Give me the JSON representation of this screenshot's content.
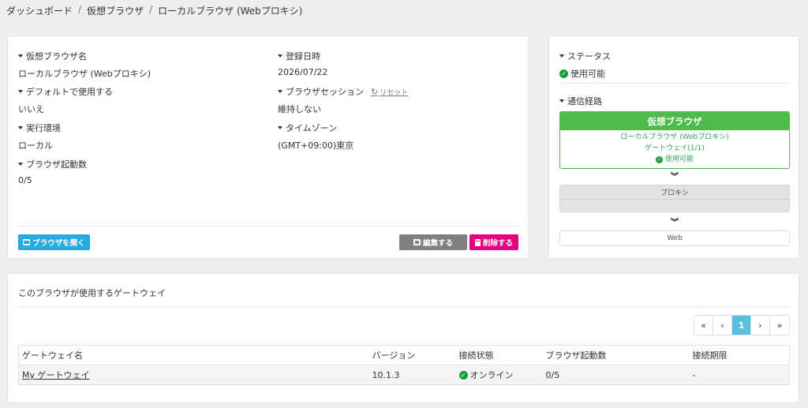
{
  "breadcrumb": {
    "items": [
      "ダッシュボード",
      "仮想ブラウザ",
      "ローカルブラウザ (Webプロキシ)"
    ],
    "separator": "/"
  },
  "details": {
    "name_label": "仮想ブラウザ名",
    "name_value": "ローカルブラウザ (Webプロキシ)",
    "registered_label": "登録日時",
    "registered_value": "2026/07/22",
    "default_label": "デフォルトで使用する",
    "default_value": "いいえ",
    "session_label": "ブラウザセッション",
    "session_reset": "リセット",
    "session_value": "維持しない",
    "env_label": "実行環境",
    "env_value": "ローカル",
    "tz_label": "タイムゾーン",
    "tz_value": "(GMT+09:00)東京",
    "launch_label": "ブラウザ起動数",
    "launch_value": "0/5"
  },
  "actions": {
    "open_label": "ブラウザを開く",
    "edit_label": "編集する",
    "delete_label": "削除する"
  },
  "status": {
    "status_label": "ステータス",
    "status_value": "使用可能",
    "route_label": "通信経路",
    "vb_header": "仮想ブラウザ",
    "vb_name": "ローカルブラウザ (Webプロキシ)",
    "vb_gateway": "ゲートウェイ(1/1)",
    "vb_status": "使用可能",
    "proxy_header": "プロキシ",
    "web_label": "Web"
  },
  "gateways": {
    "title": "このブラウザが使用するゲートウェイ",
    "pager": {
      "first": "«",
      "prev": "‹",
      "page": "1",
      "next": "›",
      "last": "»"
    },
    "columns": [
      "ゲートウェイ名",
      "バージョン",
      "接続状態",
      "ブラウザ起動数",
      "接続期限"
    ],
    "rows": [
      {
        "name": "My ゲートウェイ",
        "version": "10.1.3",
        "state": "オンライン",
        "launches": "0/5",
        "expiry": "-"
      }
    ]
  },
  "colors": {
    "accent_blue": "#29a9e0",
    "delete_pink": "#e5007f",
    "ok_green": "#1e9b3a",
    "route_green": "#4cbb4c"
  }
}
